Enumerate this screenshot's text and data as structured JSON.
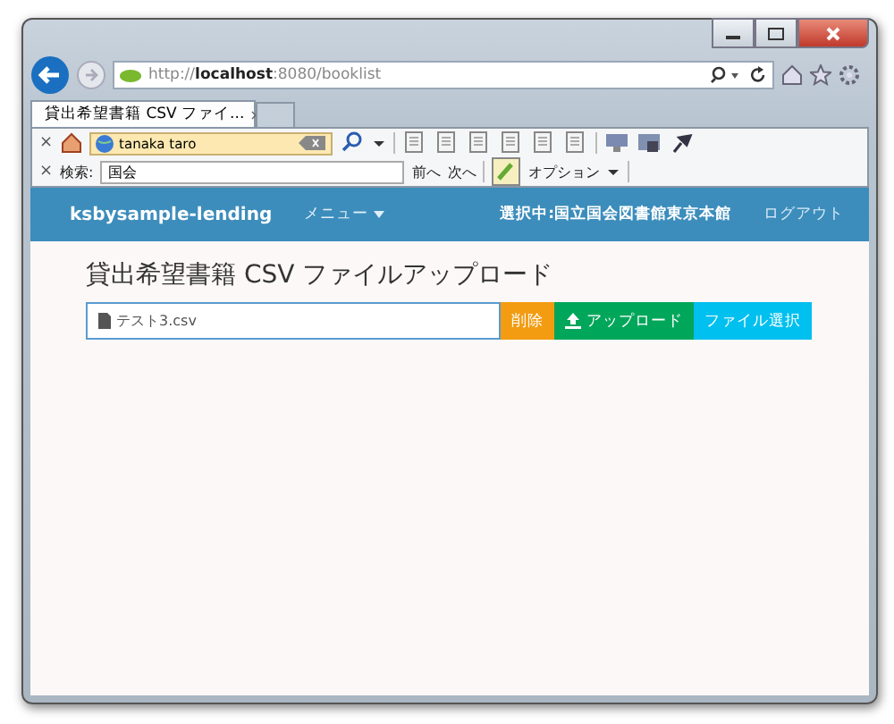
{
  "browser": {
    "address": "http://**localhost**:8080/booklist",
    "tab": {
      "title": "貸出希望書籍 CSV ファイ...",
      "close": "×"
    },
    "toolbar": {
      "close": "×",
      "user_field": {
        "value": "tanaka taro"
      }
    },
    "find_bar": {
      "close": "×",
      "label": "検索:",
      "query": {
        "value": "国会"
      },
      "prev": "前へ",
      "next": "次へ",
      "options": "オプション"
    }
  },
  "navbar": {
    "brand": "ksbysample-lending",
    "menu": "メニュー",
    "selected_library": "選択中:国立国会図書館東京本館",
    "logout": "ログアウト"
  },
  "page": {
    "title": "貸出希望書籍 CSV ファイルアップロード",
    "file_name": "テスト3.csv",
    "buttons": [
      {
        "kind": "delete",
        "label": "削除"
      },
      {
        "kind": "upload",
        "label": "アップロード"
      },
      {
        "kind": "select",
        "label": "ファイル選択"
      }
    ]
  }
}
